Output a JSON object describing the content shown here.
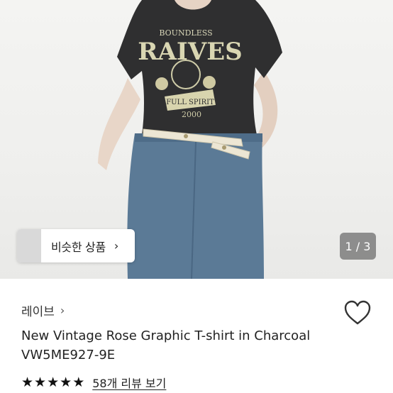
{
  "image": {
    "graphic_text_top": "BOUNDLESS",
    "graphic_text_main": "RAIVES",
    "graphic_text_banner": "FULL SPIRIT",
    "graphic_text_year": "2000"
  },
  "overlay": {
    "similar_label": "비슷한 상품",
    "similar_chevron": "›",
    "counter": "1 / 3"
  },
  "product": {
    "brand": "레이브",
    "brand_chevron": "›",
    "title_line1": "New Vintage Rose Graphic T-shirt in Charcoal",
    "title_line2": "VW5ME927-9E",
    "rating": 5,
    "review_link": "58개 리뷰 보기",
    "icons": {
      "wishlist": "heart-outline-icon",
      "star": "star-icon"
    }
  }
}
